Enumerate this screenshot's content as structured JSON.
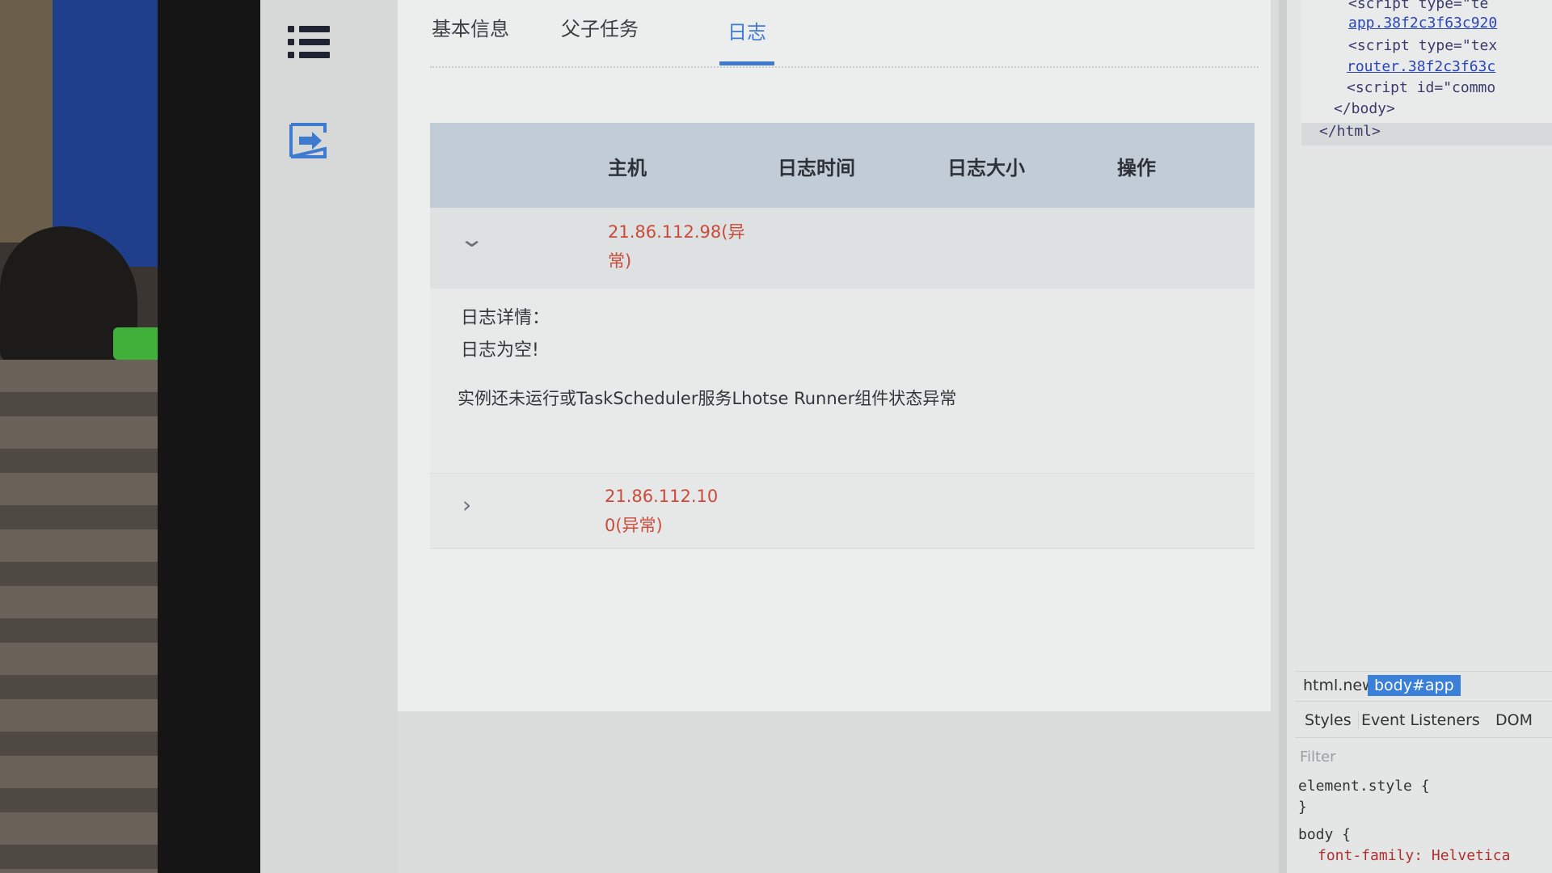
{
  "tabs": [
    {
      "label": "基本信息",
      "active": false
    },
    {
      "label": "父子任务",
      "active": false
    },
    {
      "label": "日志",
      "active": true
    }
  ],
  "table": {
    "headers": [
      "主机",
      "日志时间",
      "日志大小",
      "操作"
    ],
    "rows": [
      {
        "expanded": true,
        "host_line1": "21.86.112.98(异",
        "host_line2": "常)",
        "detail_label": "日志详情：",
        "detail_empty": "日志为空!",
        "detail_message": "实例还未运行或TaskScheduler服务Lhotse Runner组件状态异常"
      },
      {
        "expanded": false,
        "host_line1": "21.86.112.10",
        "host_line2": "0(异常)"
      }
    ]
  },
  "devtools": {
    "code_lines": [
      "<script type=\"te",
      "app.38f2c3f63c920",
      "<script type=\"tex",
      "router.38f2c3f63c",
      "<script id=\"commo",
      "</body>",
      "</html>"
    ],
    "breadcrumbs": [
      "html.new",
      "body#app"
    ],
    "panel_tabs": [
      "Styles",
      "Event Listeners",
      "DOM"
    ],
    "filter_placeholder": "Filter",
    "rules": [
      "element.style {",
      "}",
      "body {",
      "font-family: Helvetica"
    ]
  },
  "colors": {
    "accent": "#3f7ad1",
    "error_text": "#cc4a3a",
    "table_header_bg": "#c2ccd6"
  },
  "icons": {
    "menu": "list-menu-icon",
    "exit": "exit-arrow-icon",
    "collapse": "chevron-down-icon",
    "expand": "chevron-right-icon"
  }
}
